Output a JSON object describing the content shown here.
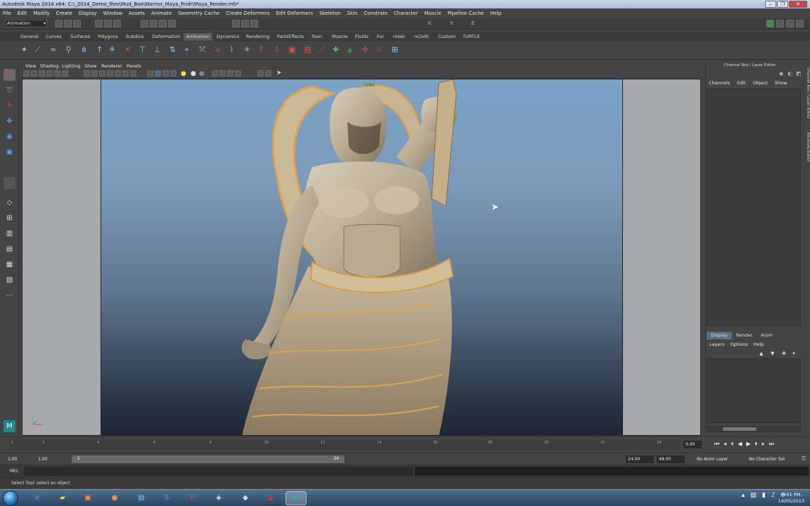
{
  "window": {
    "title": "Autodesk Maya 2014 x64: C:\\_2014_Demo_files\\Mud_Box\\Warrior_Maya_Rndr\\Maya_Render.mb*",
    "buttons": [
      "‒",
      "❐",
      "✕"
    ]
  },
  "menubar": [
    "File",
    "Edit",
    "Modify",
    "Create",
    "Display",
    "Window",
    "Assets",
    "Animate",
    "Geometry Cache",
    "Create Deformers",
    "Edit Deformers",
    "Skeleton",
    "Skin",
    "Constrain",
    "Character",
    "Muscle",
    "Pipeline Cache",
    "Help"
  ],
  "status_line": {
    "menu_set": "Animation",
    "coord_labels": [
      "X:",
      "Y:",
      "Z:"
    ]
  },
  "shelf": {
    "tabs": [
      "General",
      "Curves",
      "Surfaces",
      "Polygons",
      "Subdivs",
      "Deformation",
      "Animation",
      "Dynamics",
      "Rendering",
      "PaintEffects",
      "Toon",
      "Muscle",
      "Fluids",
      "Fur",
      "nHair",
      "nCloth",
      "Custom",
      "TURTLE"
    ],
    "active_tab": "Animation"
  },
  "viewport": {
    "menu": [
      "View",
      "Shading",
      "Lighting",
      "Show",
      "Renderer",
      "Panels"
    ],
    "camera_label": "1280"
  },
  "channel_box": {
    "title": "Channel Box / Layer Editor",
    "menu": [
      "Channels",
      "Edit",
      "Object",
      "Show"
    ],
    "side_tabs": [
      "Channel Box / Layer Editor",
      "Attribute Editor"
    ],
    "layer_tabs": [
      "Display",
      "Render",
      "Anim"
    ],
    "active_layer_tab": "Display",
    "layer_menu": [
      "Layers",
      "Options",
      "Help"
    ]
  },
  "time_slider": {
    "ticks": [
      "1",
      "2",
      "4",
      "6",
      "8",
      "10",
      "12",
      "14",
      "16",
      "18",
      "20",
      "22",
      "24"
    ],
    "current_time": "0.00"
  },
  "range_slider": {
    "start_time": "1.00",
    "playback_start": "1.00",
    "range_start_label": "1",
    "range_end_label": "24",
    "playback_end": "24.00",
    "end_time": "48.00",
    "anim_layer": "No Anim Layer",
    "character_set": "No Character Set"
  },
  "command_line": {
    "label": "MEL"
  },
  "help_line": {
    "text": "Select Tool: select an object"
  },
  "taskbar": {
    "clock_time": "6:01 PM",
    "clock_date": "14/05/2013"
  }
}
